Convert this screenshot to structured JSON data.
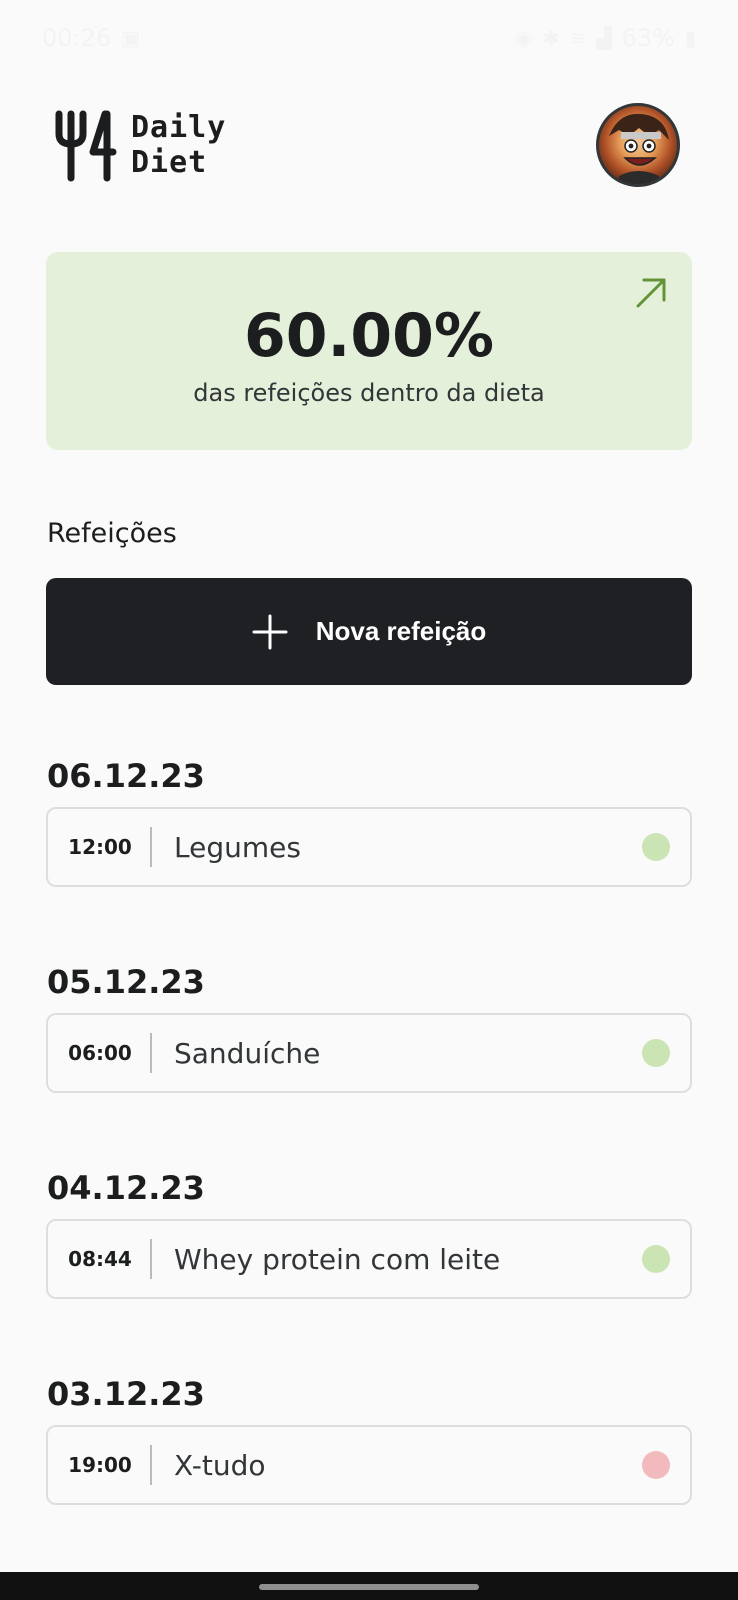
{
  "status_bar": {
    "time": "00:26",
    "battery": "63%"
  },
  "app": {
    "logo_line1": "Daily",
    "logo_line2": "Diet"
  },
  "stats": {
    "percentage": "60.00%",
    "caption": "das refeições dentro da dieta",
    "accent_color": "#639339",
    "background_color": "#E5F0DB"
  },
  "meals_section": {
    "title": "Refeições",
    "new_meal_label": "Nova refeição"
  },
  "days": [
    {
      "date": "06.12.23",
      "meals": [
        {
          "time": "12:00",
          "name": "Legumes",
          "in_diet": true
        }
      ]
    },
    {
      "date": "05.12.23",
      "meals": [
        {
          "time": "06:00",
          "name": "Sanduíche",
          "in_diet": true
        }
      ]
    },
    {
      "date": "04.12.23",
      "meals": [
        {
          "time": "08:44",
          "name": "Whey protein com leite",
          "in_diet": true
        }
      ]
    },
    {
      "date": "03.12.23",
      "meals": [
        {
          "time": "19:00",
          "name": "X-tudo",
          "in_diet": false
        }
      ]
    }
  ],
  "colors": {
    "in_diet": "#CBE4B4",
    "off_diet": "#F3BABD",
    "dark_button": "#1F2023"
  }
}
